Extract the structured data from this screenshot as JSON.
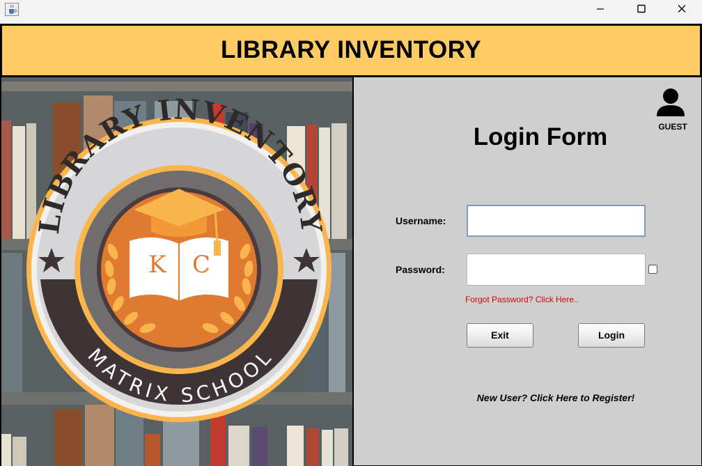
{
  "window": {
    "app_icon": "java-cup-icon",
    "controls": [
      "minimize-icon",
      "maximize-icon",
      "close-icon"
    ]
  },
  "header": {
    "title": "LIBRARY INVENTORY"
  },
  "logo": {
    "arc_text": "LIBRARY INVENTORY",
    "monogram_left": "K",
    "monogram_right": "C",
    "school_name": "MATRIX SCHOOL",
    "colors": {
      "ring": "#fbb54d",
      "band": "#3e3436",
      "center": "#e07a30",
      "cap": "#fbb54d"
    }
  },
  "user": {
    "label": "GUEST",
    "icon": "user-icon"
  },
  "form": {
    "title": "Login Form",
    "username_label": "Username:",
    "username_value": "",
    "password_label": "Password:",
    "password_value": "",
    "show_password_checked": false,
    "forgot_link": "Forgot Password? Click Here..",
    "exit_label": "Exit",
    "login_label": "Login",
    "register_link": "New User? Click Here to Register!"
  },
  "colors": {
    "header_bg": "#fecb65",
    "panel_bg": "#cfcfcf",
    "link_red": "#e00000"
  }
}
